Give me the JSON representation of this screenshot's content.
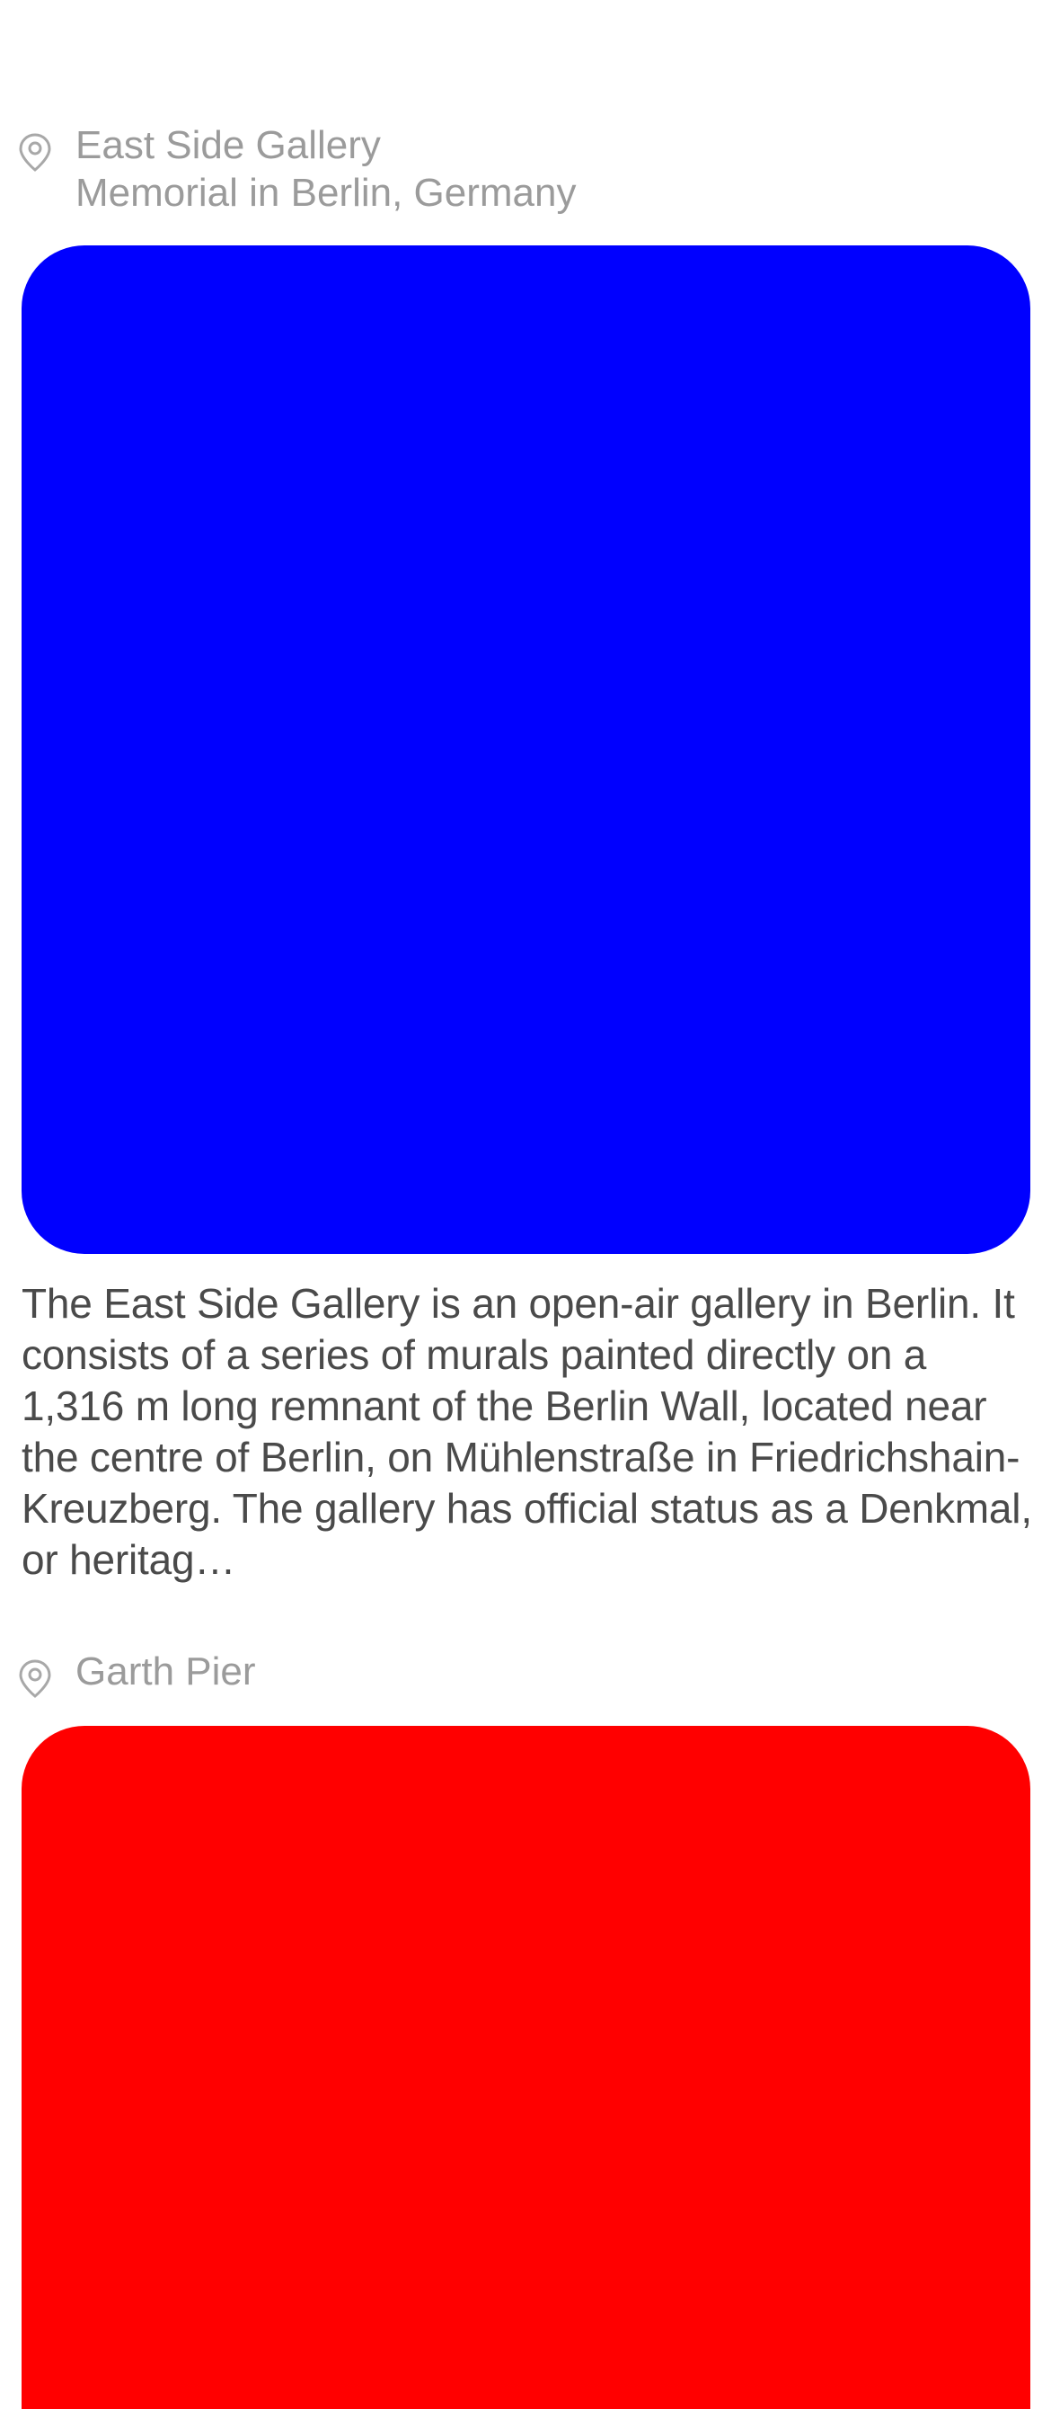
{
  "feed": {
    "items": [
      {
        "title": "East Side Gallery",
        "subtitle": "Memorial in Berlin, Germany",
        "image_color": "#0000ff",
        "description": "The East Side Gallery is an open-air gallery in Berlin. It consists of a series of murals painted directly on a 1,316 m long remnant of the Berlin Wall, located near the centre of Berlin, on Mühlenstraße in Friedrichshain-Kreuzberg. The gallery has official status as a Denkmal, or heritag…",
        "icon": "location-pin-icon"
      },
      {
        "title": "Garth Pier",
        "image_color": "#ff0000",
        "icon": "location-pin-icon"
      }
    ]
  }
}
